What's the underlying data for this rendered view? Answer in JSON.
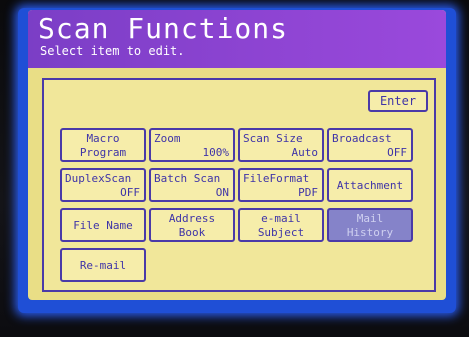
{
  "screen": {
    "title": "Scan Functions",
    "subtitle": "Select item to edit."
  },
  "enter_label": "Enter",
  "buttons": {
    "macro": {
      "line1": "Macro",
      "line2": "Program"
    },
    "zoom": {
      "label": "Zoom",
      "value": "100%"
    },
    "scan_size": {
      "label": "Scan Size",
      "value": "Auto"
    },
    "broadcast": {
      "label": "Broadcast",
      "value": "OFF"
    },
    "duplex_scan": {
      "label": "DuplexScan",
      "value": "OFF"
    },
    "batch_scan": {
      "label": "Batch Scan",
      "value": "ON"
    },
    "file_format": {
      "label": "FileFormat",
      "value": "PDF"
    },
    "attachment": {
      "label": "Attachment"
    },
    "file_name": {
      "label": "File Name"
    },
    "address_book": {
      "line1": "Address",
      "line2": "Book"
    },
    "email_subject": {
      "line1": "e-mail",
      "line2": "Subject"
    },
    "mail_history": {
      "line1": "Mail",
      "line2": "History"
    },
    "re_mail": {
      "label": "Re-mail"
    }
  },
  "colors": {
    "screen_bg": "#e9de86",
    "header": "#8d44d2",
    "button_border": "#4a3aa8",
    "text": "#3f34a8",
    "selected": "#8583c9",
    "backlight": "#1f4fd6"
  }
}
